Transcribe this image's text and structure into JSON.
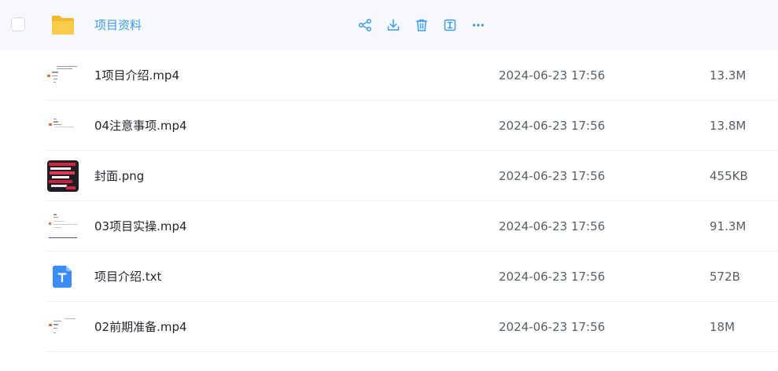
{
  "folder": {
    "name": "项目资料",
    "actions": [
      {
        "icon": "share-icon"
      },
      {
        "icon": "download-icon"
      },
      {
        "icon": "trash-icon"
      },
      {
        "icon": "rename-icon"
      },
      {
        "icon": "more-icon"
      }
    ]
  },
  "files": [
    {
      "name": "1项目介绍.mp4",
      "time": "2024-06-23 17:56",
      "size": "13.3M",
      "kind": "video"
    },
    {
      "name": "04注意事项.mp4",
      "time": "2024-06-23 17:56",
      "size": "13.8M",
      "kind": "video"
    },
    {
      "name": "封面.png",
      "time": "2024-06-23 17:56",
      "size": "455KB",
      "kind": "image"
    },
    {
      "name": "03项目实操.mp4",
      "time": "2024-06-23 17:56",
      "size": "91.3M",
      "kind": "video"
    },
    {
      "name": "项目介绍.txt",
      "time": "2024-06-23 17:56",
      "size": "572B",
      "kind": "text"
    },
    {
      "name": "02前期准备.mp4",
      "time": "2024-06-23 17:56",
      "size": "18M",
      "kind": "video"
    }
  ],
  "colors": {
    "accent": "#3d9bf0",
    "folder": "#f7c33a",
    "txt_icon": "#3b8cf5",
    "hover_bg": "#f6f8fb"
  }
}
